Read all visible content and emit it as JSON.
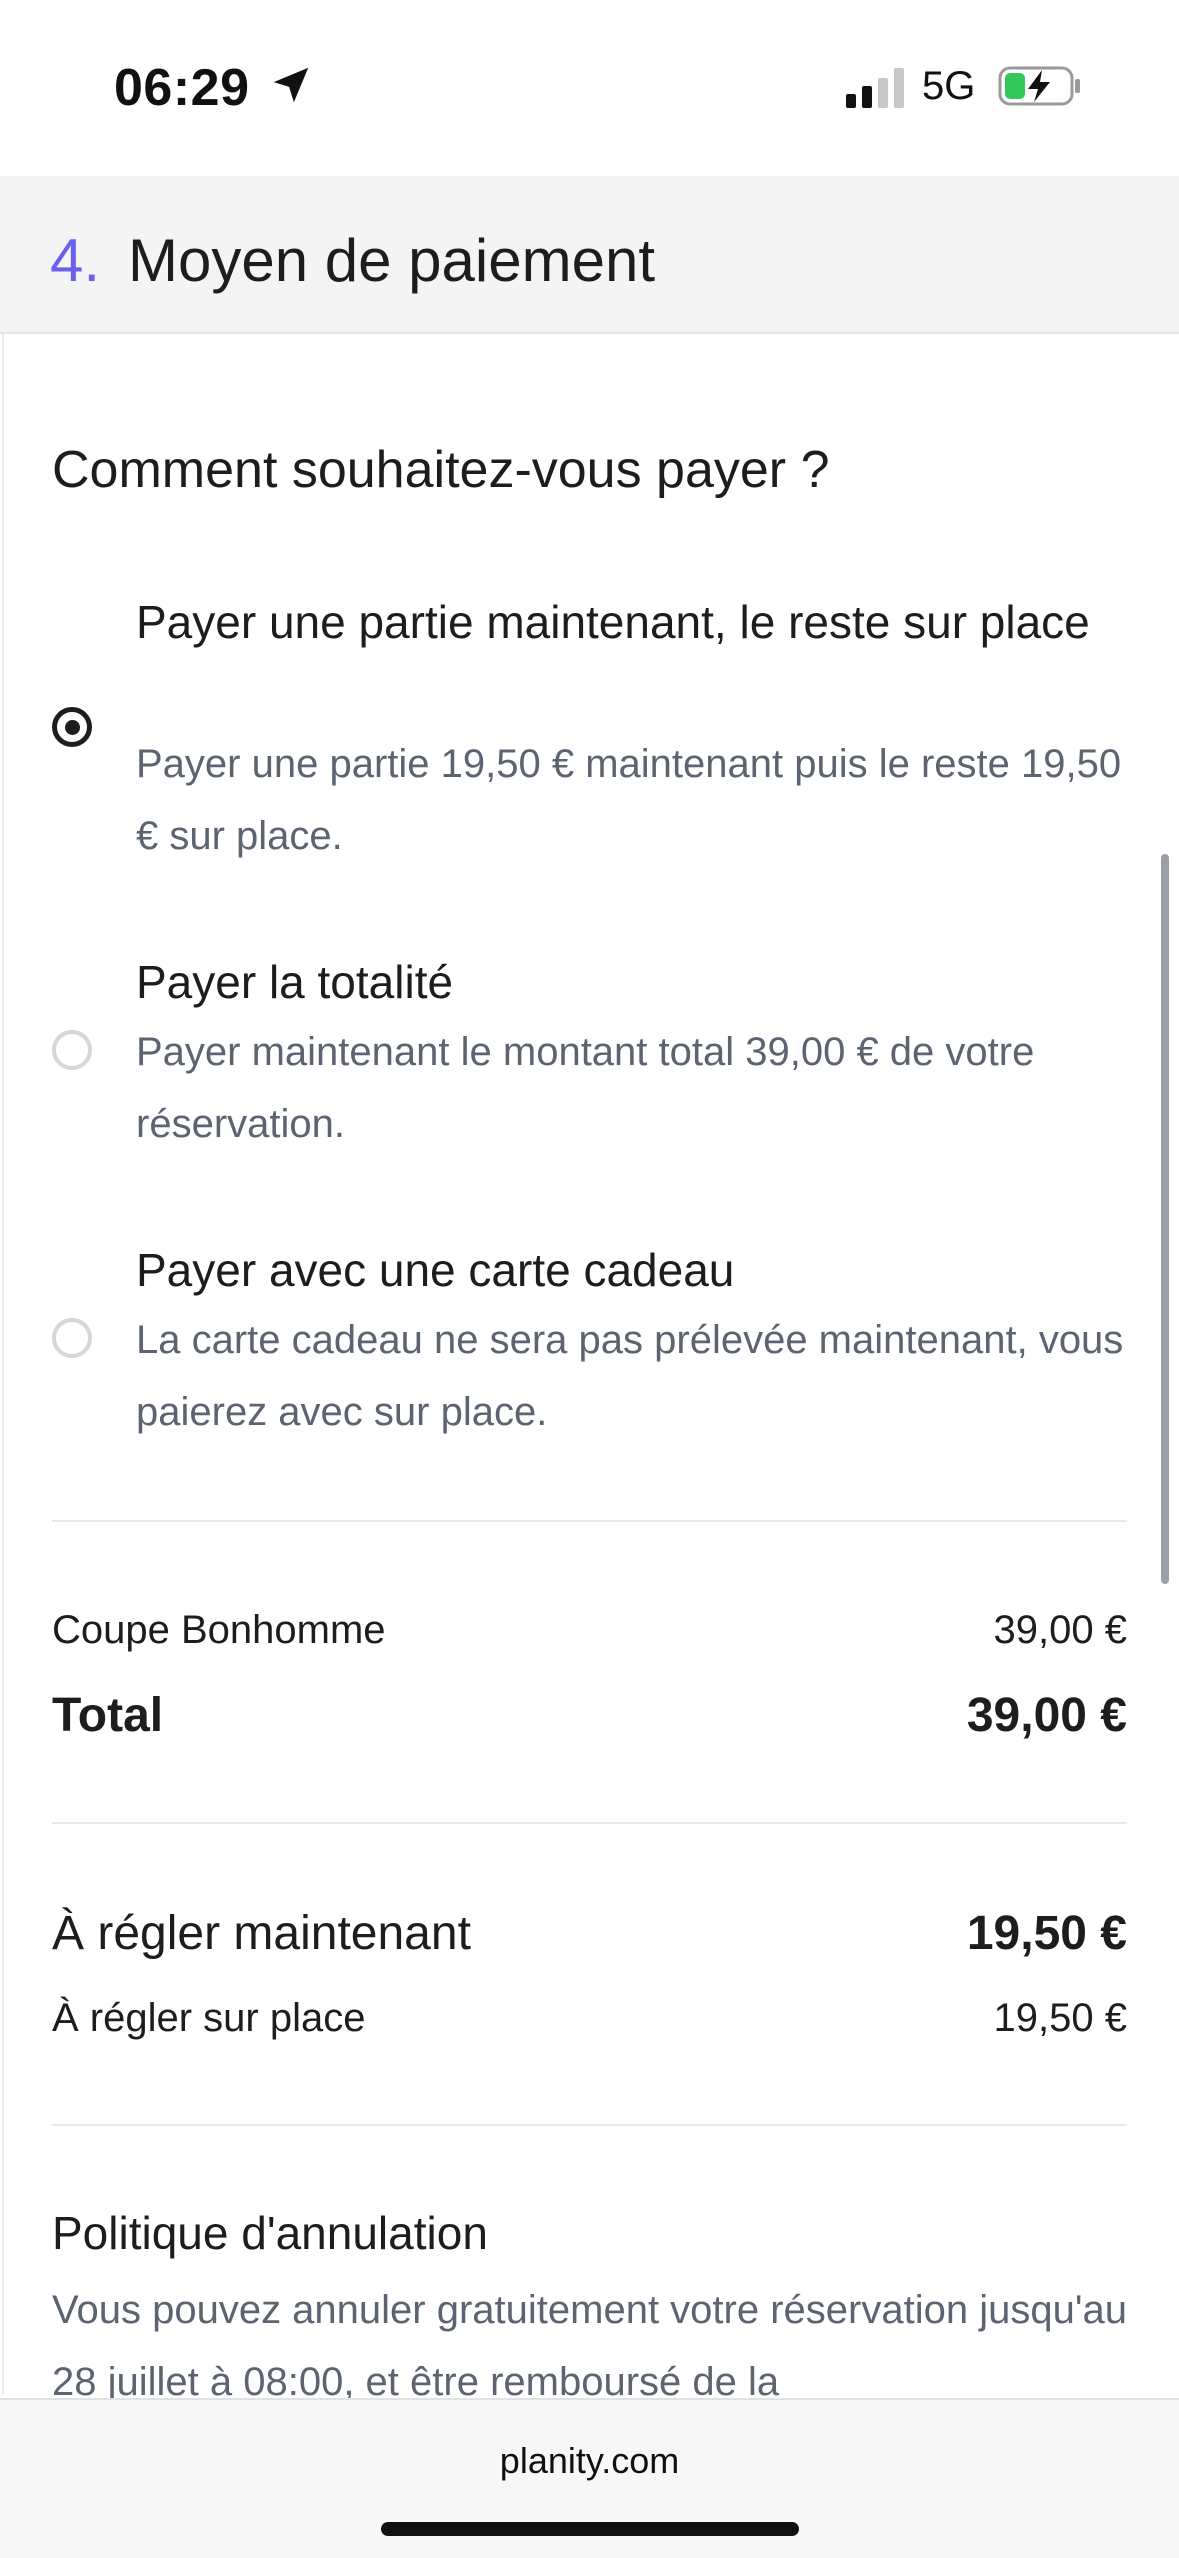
{
  "status_bar": {
    "time": "06:29",
    "network": "5G"
  },
  "header": {
    "step_number": "4.",
    "title": "Moyen de paiement"
  },
  "question": "Comment souhaitez-vous payer ?",
  "options": [
    {
      "title": "Payer une partie maintenant, le reste sur place",
      "description": "Payer une partie 19,50 € maintenant puis le reste 19,50 € sur place.",
      "selected": true
    },
    {
      "title": "Payer la totalité",
      "description": "Payer maintenant le montant total 39,00 € de votre réservation.",
      "selected": false
    },
    {
      "title": "Payer avec une carte cadeau",
      "description": "La carte cadeau ne sera pas prélevée maintenant, vous paierez avec sur place.",
      "selected": false
    }
  ],
  "summary": {
    "item_label": "Coupe Bonhomme",
    "item_price": "39,00 €",
    "total_label": "Total",
    "total_value": "39,00 €"
  },
  "payment": {
    "now_label": "À régler maintenant",
    "now_value": "19,50 €",
    "onsite_label": "À régler sur place",
    "onsite_value": "19,50 €"
  },
  "policy": {
    "title": "Politique d'annulation",
    "text": "Vous pouvez annuler gratuitement votre réservation jusqu'au 28 juillet à 08:00, et être remboursé de la"
  },
  "browser": {
    "domain": "planity.com"
  }
}
